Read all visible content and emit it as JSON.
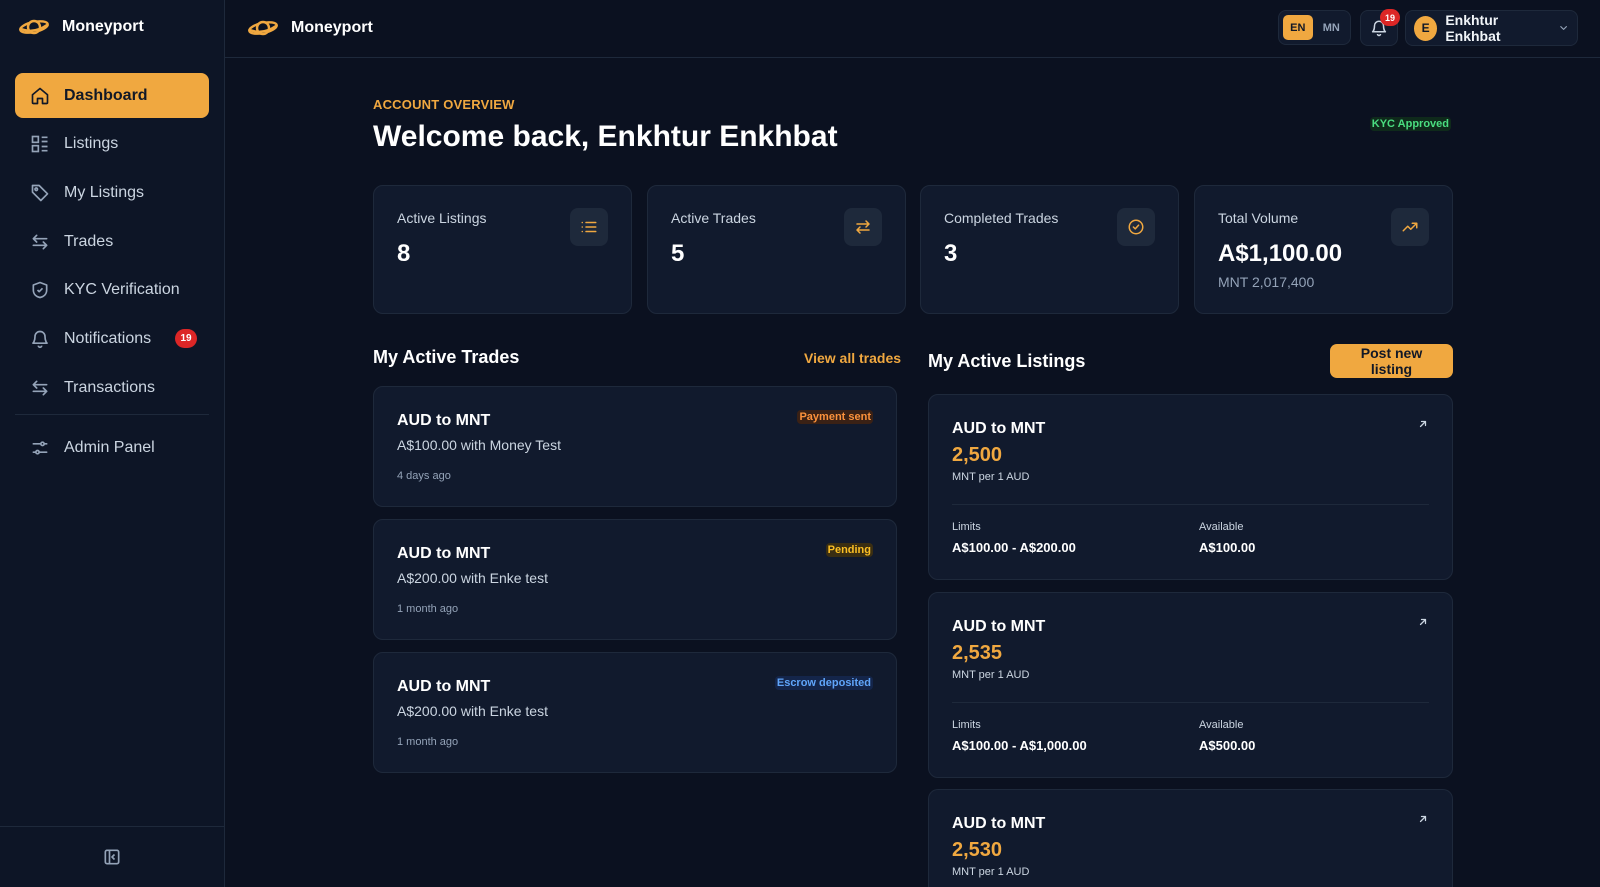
{
  "app": {
    "name": "Moneyport"
  },
  "sidebar": {
    "items": [
      {
        "label": "Dashboard",
        "icon": "home-icon",
        "active": true
      },
      {
        "label": "Listings",
        "icon": "list-grid-icon"
      },
      {
        "label": "My Listings",
        "icon": "tag-icon"
      },
      {
        "label": "Trades",
        "icon": "swap-arrows-icon"
      },
      {
        "label": "KYC Verification",
        "icon": "shield-check-icon"
      },
      {
        "label": "Notifications",
        "icon": "bell-icon",
        "badge": "19"
      },
      {
        "label": "Transactions",
        "icon": "swap-arrows-icon"
      }
    ],
    "admin": {
      "label": "Admin Panel",
      "icon": "sliders-icon"
    }
  },
  "topbar": {
    "langs": [
      "EN",
      "MN"
    ],
    "active_lang": "EN",
    "notification_count": "19",
    "user": {
      "initial": "E",
      "name": "Enkhtur Enkhbat"
    }
  },
  "overview": {
    "eyebrow": "ACCOUNT OVERVIEW",
    "welcome": "Welcome back, Enkhtur Enkhbat",
    "kyc_status": "KYC Approved"
  },
  "stats": [
    {
      "label": "Active Listings",
      "value": "8",
      "icon": "list-icon"
    },
    {
      "label": "Active Trades",
      "value": "5",
      "icon": "swap-arrows-icon"
    },
    {
      "label": "Completed Trades",
      "value": "3",
      "icon": "check-circle-icon"
    },
    {
      "label": "Total Volume",
      "value": "A$1,100.00",
      "sub": "MNT 2,017,400",
      "icon": "trending-up-icon"
    }
  ],
  "trades_section": {
    "title": "My Active Trades",
    "view_all": "View all trades",
    "items": [
      {
        "pair": "AUD to MNT",
        "desc": "A$100.00 with Money Test",
        "time": "4 days ago",
        "status": "Payment sent",
        "status_color": "#fb923c",
        "status_bg": "#3a2115"
      },
      {
        "pair": "AUD to MNT",
        "desc": "A$200.00 with Enke test",
        "time": "1 month ago",
        "status": "Pending",
        "status_color": "#fbbf24",
        "status_bg": "#3a2e12"
      },
      {
        "pair": "AUD to MNT",
        "desc": "A$200.00 with Enke test",
        "time": "1 month ago",
        "status": "Escrow deposited",
        "status_color": "#60a5fa",
        "status_bg": "#14254a"
      }
    ]
  },
  "listings_section": {
    "title": "My Active Listings",
    "post_button": "Post new listing",
    "limits_label": "Limits",
    "available_label": "Available",
    "items": [
      {
        "pair": "AUD to MNT",
        "rate": "2,500",
        "unit": "MNT per 1 AUD",
        "limits": "A$100.00 - A$200.00",
        "available": "A$100.00"
      },
      {
        "pair": "AUD to MNT",
        "rate": "2,535",
        "unit": "MNT per 1 AUD",
        "limits": "A$100.00 - A$1,000.00",
        "available": "A$500.00"
      },
      {
        "pair": "AUD to MNT",
        "rate": "2,530",
        "unit": "MNT per 1 AUD"
      }
    ]
  },
  "colors": {
    "accent": "#f0a840",
    "background": "#0b1120",
    "card": "#111a2d",
    "success": "#4ade80",
    "danger": "#dc2626"
  }
}
